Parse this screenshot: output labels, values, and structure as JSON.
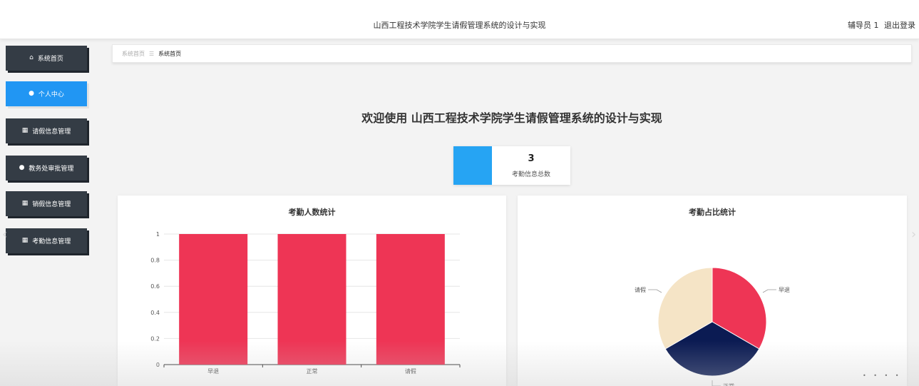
{
  "header": {
    "title": "山西工程技术学院学生请假管理系统的设计与实现",
    "user_label": "辅导员 1",
    "logout_label": "退出登录"
  },
  "sidebar": {
    "items": [
      {
        "label": "系统首页",
        "icon": "home-icon",
        "glyph": "⌂"
      },
      {
        "label": "个人中心",
        "icon": "user-icon",
        "glyph": "●"
      },
      {
        "label": "请假信息管理",
        "icon": "grid-icon",
        "glyph": "▦"
      },
      {
        "label": "教务处审批管理",
        "icon": "bulb-icon",
        "glyph": "●"
      },
      {
        "label": "销假信息管理",
        "icon": "grid-icon",
        "glyph": "▦"
      },
      {
        "label": "考勤信息管理",
        "icon": "grid-icon",
        "glyph": "▦"
      }
    ],
    "active_index": 1
  },
  "breadcrumb": {
    "items": [
      "系统首页",
      "系统首页"
    ],
    "separator": "☰"
  },
  "welcome": {
    "text": "欢迎使用 山西工程技术学院学生请假管理系统的设计与实现"
  },
  "stat": {
    "value": "3",
    "label": "考勤信息总数",
    "color": "#26a4f3"
  },
  "chart_data": [
    {
      "type": "bar",
      "title": "考勤人数统计",
      "categories": [
        "早退",
        "正常",
        "请假"
      ],
      "values": [
        1,
        1,
        1
      ],
      "ylim": [
        0,
        1
      ],
      "yticks": [
        "0",
        "0.2",
        "0.4",
        "0.6",
        "0.8",
        "1"
      ],
      "color": "#ee3555",
      "grid": true
    },
    {
      "type": "pie",
      "title": "考勤占比统计",
      "labels": [
        "早退",
        "正常",
        "请假"
      ],
      "values": [
        1,
        1,
        1
      ],
      "colors": [
        "#ee3555",
        "#0b1b53",
        "#f5e4c6"
      ]
    }
  ],
  "colors": {
    "sidebar_bg": "#343c45",
    "active": "#2196f3"
  }
}
